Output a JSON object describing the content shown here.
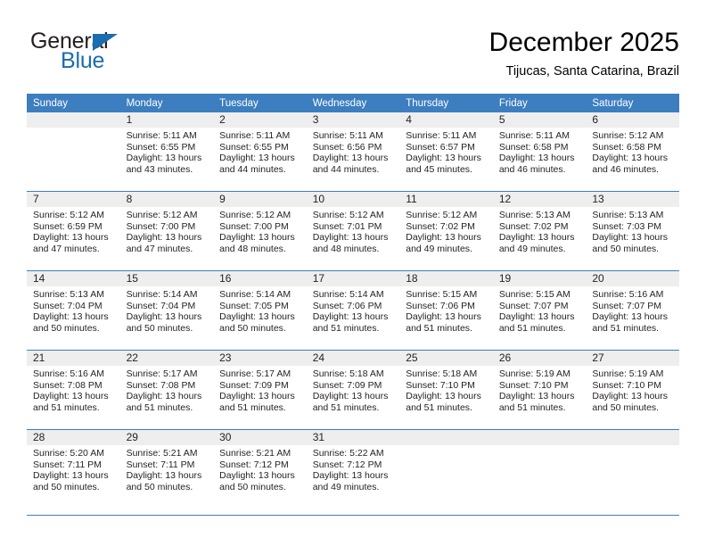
{
  "logo": {
    "word_top": "General",
    "word_bottom": "Blue",
    "triangle": "triangle-icon",
    "accent_color": "#1b6cb0"
  },
  "header": {
    "title": "December 2025",
    "subtitle": "Tijucas, Santa Catarina, Brazil"
  },
  "colors": {
    "header_blue": "#3c7ebf",
    "daynum_gray": "#eeeeee",
    "text": "#231f20"
  },
  "weekdays": [
    "Sunday",
    "Monday",
    "Tuesday",
    "Wednesday",
    "Thursday",
    "Friday",
    "Saturday"
  ],
  "weeks": [
    [
      {
        "day": "",
        "sunrise": "",
        "sunset": "",
        "daylight1": "",
        "daylight2": ""
      },
      {
        "day": "1",
        "sunrise": "Sunrise: 5:11 AM",
        "sunset": "Sunset: 6:55 PM",
        "daylight1": "Daylight: 13 hours",
        "daylight2": "and 43 minutes."
      },
      {
        "day": "2",
        "sunrise": "Sunrise: 5:11 AM",
        "sunset": "Sunset: 6:55 PM",
        "daylight1": "Daylight: 13 hours",
        "daylight2": "and 44 minutes."
      },
      {
        "day": "3",
        "sunrise": "Sunrise: 5:11 AM",
        "sunset": "Sunset: 6:56 PM",
        "daylight1": "Daylight: 13 hours",
        "daylight2": "and 44 minutes."
      },
      {
        "day": "4",
        "sunrise": "Sunrise: 5:11 AM",
        "sunset": "Sunset: 6:57 PM",
        "daylight1": "Daylight: 13 hours",
        "daylight2": "and 45 minutes."
      },
      {
        "day": "5",
        "sunrise": "Sunrise: 5:11 AM",
        "sunset": "Sunset: 6:58 PM",
        "daylight1": "Daylight: 13 hours",
        "daylight2": "and 46 minutes."
      },
      {
        "day": "6",
        "sunrise": "Sunrise: 5:12 AM",
        "sunset": "Sunset: 6:58 PM",
        "daylight1": "Daylight: 13 hours",
        "daylight2": "and 46 minutes."
      }
    ],
    [
      {
        "day": "7",
        "sunrise": "Sunrise: 5:12 AM",
        "sunset": "Sunset: 6:59 PM",
        "daylight1": "Daylight: 13 hours",
        "daylight2": "and 47 minutes."
      },
      {
        "day": "8",
        "sunrise": "Sunrise: 5:12 AM",
        "sunset": "Sunset: 7:00 PM",
        "daylight1": "Daylight: 13 hours",
        "daylight2": "and 47 minutes."
      },
      {
        "day": "9",
        "sunrise": "Sunrise: 5:12 AM",
        "sunset": "Sunset: 7:00 PM",
        "daylight1": "Daylight: 13 hours",
        "daylight2": "and 48 minutes."
      },
      {
        "day": "10",
        "sunrise": "Sunrise: 5:12 AM",
        "sunset": "Sunset: 7:01 PM",
        "daylight1": "Daylight: 13 hours",
        "daylight2": "and 48 minutes."
      },
      {
        "day": "11",
        "sunrise": "Sunrise: 5:12 AM",
        "sunset": "Sunset: 7:02 PM",
        "daylight1": "Daylight: 13 hours",
        "daylight2": "and 49 minutes."
      },
      {
        "day": "12",
        "sunrise": "Sunrise: 5:13 AM",
        "sunset": "Sunset: 7:02 PM",
        "daylight1": "Daylight: 13 hours",
        "daylight2": "and 49 minutes."
      },
      {
        "day": "13",
        "sunrise": "Sunrise: 5:13 AM",
        "sunset": "Sunset: 7:03 PM",
        "daylight1": "Daylight: 13 hours",
        "daylight2": "and 50 minutes."
      }
    ],
    [
      {
        "day": "14",
        "sunrise": "Sunrise: 5:13 AM",
        "sunset": "Sunset: 7:04 PM",
        "daylight1": "Daylight: 13 hours",
        "daylight2": "and 50 minutes."
      },
      {
        "day": "15",
        "sunrise": "Sunrise: 5:14 AM",
        "sunset": "Sunset: 7:04 PM",
        "daylight1": "Daylight: 13 hours",
        "daylight2": "and 50 minutes."
      },
      {
        "day": "16",
        "sunrise": "Sunrise: 5:14 AM",
        "sunset": "Sunset: 7:05 PM",
        "daylight1": "Daylight: 13 hours",
        "daylight2": "and 50 minutes."
      },
      {
        "day": "17",
        "sunrise": "Sunrise: 5:14 AM",
        "sunset": "Sunset: 7:06 PM",
        "daylight1": "Daylight: 13 hours",
        "daylight2": "and 51 minutes."
      },
      {
        "day": "18",
        "sunrise": "Sunrise: 5:15 AM",
        "sunset": "Sunset: 7:06 PM",
        "daylight1": "Daylight: 13 hours",
        "daylight2": "and 51 minutes."
      },
      {
        "day": "19",
        "sunrise": "Sunrise: 5:15 AM",
        "sunset": "Sunset: 7:07 PM",
        "daylight1": "Daylight: 13 hours",
        "daylight2": "and 51 minutes."
      },
      {
        "day": "20",
        "sunrise": "Sunrise: 5:16 AM",
        "sunset": "Sunset: 7:07 PM",
        "daylight1": "Daylight: 13 hours",
        "daylight2": "and 51 minutes."
      }
    ],
    [
      {
        "day": "21",
        "sunrise": "Sunrise: 5:16 AM",
        "sunset": "Sunset: 7:08 PM",
        "daylight1": "Daylight: 13 hours",
        "daylight2": "and 51 minutes."
      },
      {
        "day": "22",
        "sunrise": "Sunrise: 5:17 AM",
        "sunset": "Sunset: 7:08 PM",
        "daylight1": "Daylight: 13 hours",
        "daylight2": "and 51 minutes."
      },
      {
        "day": "23",
        "sunrise": "Sunrise: 5:17 AM",
        "sunset": "Sunset: 7:09 PM",
        "daylight1": "Daylight: 13 hours",
        "daylight2": "and 51 minutes."
      },
      {
        "day": "24",
        "sunrise": "Sunrise: 5:18 AM",
        "sunset": "Sunset: 7:09 PM",
        "daylight1": "Daylight: 13 hours",
        "daylight2": "and 51 minutes."
      },
      {
        "day": "25",
        "sunrise": "Sunrise: 5:18 AM",
        "sunset": "Sunset: 7:10 PM",
        "daylight1": "Daylight: 13 hours",
        "daylight2": "and 51 minutes."
      },
      {
        "day": "26",
        "sunrise": "Sunrise: 5:19 AM",
        "sunset": "Sunset: 7:10 PM",
        "daylight1": "Daylight: 13 hours",
        "daylight2": "and 51 minutes."
      },
      {
        "day": "27",
        "sunrise": "Sunrise: 5:19 AM",
        "sunset": "Sunset: 7:10 PM",
        "daylight1": "Daylight: 13 hours",
        "daylight2": "and 50 minutes."
      }
    ],
    [
      {
        "day": "28",
        "sunrise": "Sunrise: 5:20 AM",
        "sunset": "Sunset: 7:11 PM",
        "daylight1": "Daylight: 13 hours",
        "daylight2": "and 50 minutes."
      },
      {
        "day": "29",
        "sunrise": "Sunrise: 5:21 AM",
        "sunset": "Sunset: 7:11 PM",
        "daylight1": "Daylight: 13 hours",
        "daylight2": "and 50 minutes."
      },
      {
        "day": "30",
        "sunrise": "Sunrise: 5:21 AM",
        "sunset": "Sunset: 7:12 PM",
        "daylight1": "Daylight: 13 hours",
        "daylight2": "and 50 minutes."
      },
      {
        "day": "31",
        "sunrise": "Sunrise: 5:22 AM",
        "sunset": "Sunset: 7:12 PM",
        "daylight1": "Daylight: 13 hours",
        "daylight2": "and 49 minutes."
      },
      {
        "day": "",
        "sunrise": "",
        "sunset": "",
        "daylight1": "",
        "daylight2": ""
      },
      {
        "day": "",
        "sunrise": "",
        "sunset": "",
        "daylight1": "",
        "daylight2": ""
      },
      {
        "day": "",
        "sunrise": "",
        "sunset": "",
        "daylight1": "",
        "daylight2": ""
      }
    ]
  ]
}
